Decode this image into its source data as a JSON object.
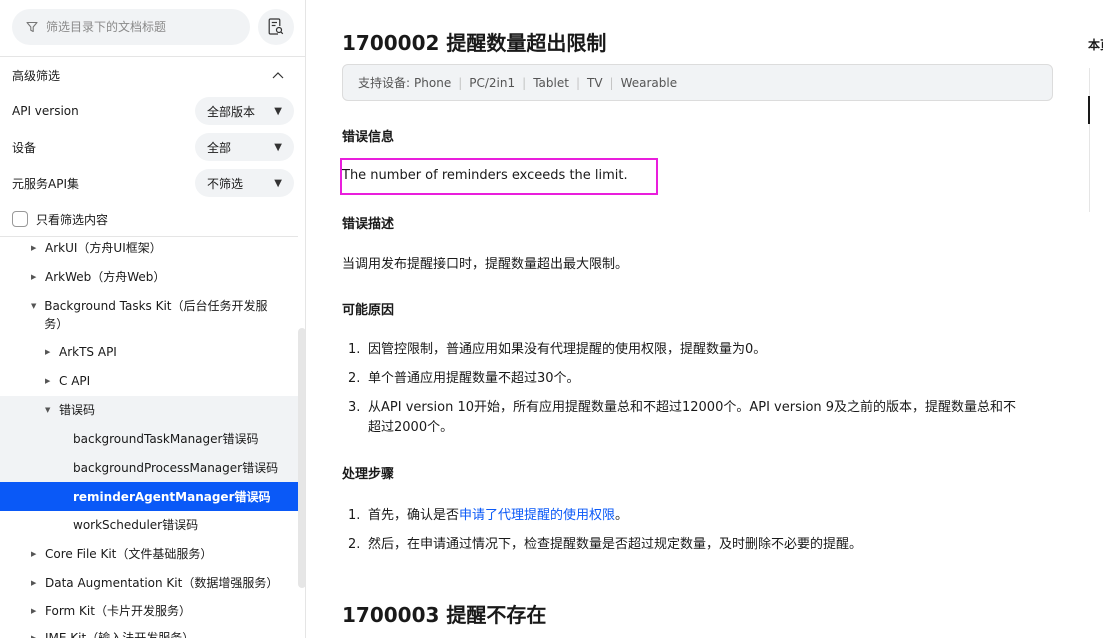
{
  "sidebar": {
    "search_placeholder": "筛选目录下的文档标题",
    "advanced_filter_label": "高级筛选",
    "filters": [
      {
        "label": "API version",
        "value": "全部版本"
      },
      {
        "label": "设备",
        "value": "全部"
      },
      {
        "label": "元服务API集",
        "value": "不筛选"
      }
    ],
    "only_filtered_label": "只看筛选内容",
    "tree": [
      {
        "label": "ArkUI（方舟UI框架）",
        "expanded": false
      },
      {
        "label": "ArkWeb（方舟Web）",
        "expanded": false
      },
      {
        "label": "Background Tasks Kit（后台任务开发服务）",
        "expanded": true
      },
      {
        "label": "ArkTS API",
        "expanded": false
      },
      {
        "label": "C API",
        "expanded": false
      },
      {
        "label": "错误码",
        "expanded": true
      },
      {
        "label": "backgroundTaskManager错误码"
      },
      {
        "label": "backgroundProcessManager错误码"
      },
      {
        "label": "reminderAgentManager错误码",
        "selected": true
      },
      {
        "label": "workScheduler错误码"
      },
      {
        "label": "Core File Kit（文件基础服务）",
        "expanded": false
      },
      {
        "label": "Data Augmentation Kit（数据增强服务）",
        "expanded": false
      },
      {
        "label": "Form Kit（卡片开发服务）",
        "expanded": false
      },
      {
        "label": "IME Kit（输入法开发服务）",
        "expanded": false
      }
    ]
  },
  "main": {
    "title": "1700002 提醒数量超出限制",
    "devices_label": "支持设备:",
    "devices": [
      "Phone",
      "PC/2in1",
      "Tablet",
      "TV",
      "Wearable"
    ],
    "error_info_heading": "错误信息",
    "error_info_text": "The number of reminders exceeds the limit.",
    "error_desc_heading": "错误描述",
    "error_desc_text": "当调用发布提醒接口时，提醒数量超出最大限制。",
    "causes_heading": "可能原因",
    "causes": [
      "因管控限制，普通应用如果没有代理提醒的使用权限，提醒数量为0。",
      "单个普通应用提醒数量不超过30个。",
      "从API version 10开始，所有应用提醒数量总和不超过12000个。API version 9及之前的版本，提醒数量总和不超过2000个。"
    ],
    "steps_heading": "处理步骤",
    "step1_prefix": "首先，确认是否",
    "step1_link": "申请了代理提醒的使用权限",
    "step1_suffix": "。",
    "step2": "然后，在申请通过情况下，检查提醒数量是否超过规定数量，及时删除不必要的提醒。",
    "next_title": "1700003 提醒不存在"
  },
  "toc": {
    "title": "本页目录"
  },
  "colors": {
    "accent": "#0a59f7",
    "highlight_box": "#e91edc"
  }
}
